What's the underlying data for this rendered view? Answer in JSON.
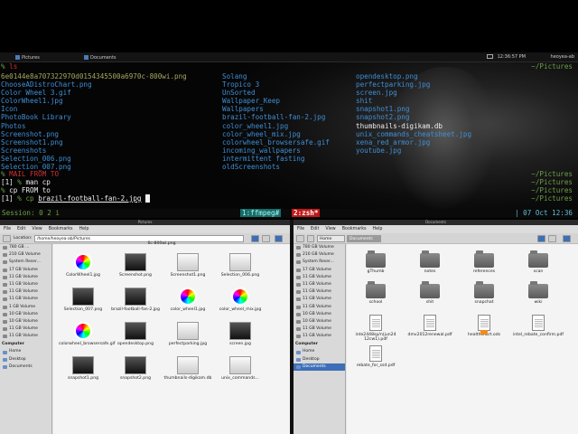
{
  "panel": {
    "tasks": [
      {
        "label": "Pictures"
      },
      {
        "label": "Documents"
      }
    ],
    "clock": "12:36:57 PM",
    "user": "heoyea-ab"
  },
  "terminal": {
    "prompt": "%",
    "cmd1": "ls",
    "col1": [
      "6e0144e8a707322970d0154345500a6970c-800wi.png",
      "ChooseADistroChart.png",
      "Color Wheel 3.gif",
      "ColorWheel1.jpg",
      "Icon",
      "PhotoBook Library",
      "Photos",
      "Screenshot.png",
      "Screenshot1.png",
      "Screenshots",
      "Selection_006.png",
      "Selection_007.png"
    ],
    "col2": [
      "Solang",
      "Tropico 3",
      "UnSorted",
      "Wallpaper_Keep",
      "Wallpapers",
      "brazil-football-fan-2.jpg",
      "color_wheel1.jpg",
      "color_wheel_mix.jpg",
      "colorwheel_browsersafe.gif",
      "incoming_wallpapers",
      "intermittent fasting",
      "oldScreenshots"
    ],
    "col3": [
      "opendesktop.png",
      "perfectparking.jpg",
      "screen.jpg",
      "shit",
      "snapshot1.png",
      "snapshot2.png",
      "thumbnails-digikam.db",
      "unix_commands_cheatsheet.jpg",
      "xena_red_armor.jpg",
      "youtube.jpg"
    ],
    "cwd": "~/Pictures",
    "line_mail": "MAIL FROM TO",
    "line_man_prefix": "[1]",
    "line_man": "man cp",
    "line_cp": "cp FROM to",
    "line_last_prefix": "[1]",
    "line_last_cmd": "cp",
    "line_last_arg": "brazil-football-fan-2.jpg",
    "session": "Session: 0 2 i",
    "win1": "1:ffmpeg#",
    "win2": "2:zsh*",
    "date": "| 07 Oct 12:36"
  },
  "left_fm": {
    "title": "Pictures",
    "menu": [
      "File",
      "Edit",
      "View",
      "Bookmarks",
      "Help"
    ],
    "location_label": "Location:",
    "location": "/home/heoyea-ab/Pictures",
    "partial_top": "6c-800wi.png",
    "sidebar_devices": [
      "780 GB ...",
      "210 GB Volume",
      "System Reser...",
      "17 GB Volume",
      "11 GB Volume",
      "11 GB Volume",
      "11 GB Volume",
      "11 GB Volume",
      "1 GB Volume",
      "10 GB Volume",
      "10 GB Volume",
      "11 GB Volume",
      "11 GB Volume"
    ],
    "sidebar_computer_hdr": "Computer",
    "sidebar_computer": [
      "Home",
      "Desktop",
      "Documents"
    ],
    "files": [
      {
        "name": "ColorWheel1.jpg",
        "kind": "wheel"
      },
      {
        "name": "Screenshot.png",
        "kind": "dark"
      },
      {
        "name": "Screenshot1.png",
        "kind": "light"
      },
      {
        "name": "Selection_006.png",
        "kind": "light"
      },
      {
        "name": "Selection_007.png",
        "kind": "dark"
      },
      {
        "name": "brazil-football-fan-2.jpg",
        "kind": "dark"
      },
      {
        "name": "color_wheel1.jpg",
        "kind": "wheel"
      },
      {
        "name": "color_wheel_mix.jpg",
        "kind": "wheel"
      },
      {
        "name": "colorwheel_browsersafe.gif",
        "kind": "wheel"
      },
      {
        "name": "opendesktop.png",
        "kind": "dark"
      },
      {
        "name": "perfectparking.jpg",
        "kind": "light"
      },
      {
        "name": "screen.jpg",
        "kind": "dark"
      },
      {
        "name": "snapshot1.png",
        "kind": "dark"
      },
      {
        "name": "snapshot2.png",
        "kind": "dark"
      },
      {
        "name": "thumbnails-digikam.db",
        "kind": "light"
      },
      {
        "name": "unix_commands...",
        "kind": "light"
      }
    ]
  },
  "right_fm": {
    "title": "Documents",
    "menu": [
      "File",
      "Edit",
      "View",
      "Bookmarks",
      "Help"
    ],
    "crumbs": [
      "Home",
      "Documents"
    ],
    "sidebar_devices": [
      "780 GB Volume",
      "210 GB Volume",
      "System Reser...",
      "17 GB Volume",
      "11 GB Volume",
      "11 GB Volume",
      "11 GB Volume",
      "11 GB Volume",
      "11 GB Volume",
      "10 GB Volume",
      "10 GB Volume",
      "11 GB Volume",
      "11 GB Volume"
    ],
    "sidebar_computer_hdr": "Computer",
    "sidebar_computer": [
      "Home",
      "Desktop",
      "Documents"
    ],
    "files": [
      {
        "name": "gThumb",
        "kind": "folder"
      },
      {
        "name": "notes",
        "kind": "folder"
      },
      {
        "name": "references",
        "kind": "folder"
      },
      {
        "name": "scan",
        "kind": "folder"
      },
      {
        "name": "school",
        "kind": "folder"
      },
      {
        "name": "shit",
        "kind": "folder"
      },
      {
        "name": "snapchat",
        "kind": "folder"
      },
      {
        "name": "wiki",
        "kind": "folder"
      },
      {
        "name": "inte2448sp/n(jun24 12cw1).pdf",
        "kind": "doc"
      },
      {
        "name": "dmv2012renewal.pdf",
        "kind": "doc"
      },
      {
        "name": "healthchart.ods",
        "kind": "sheet"
      },
      {
        "name": "intel_rebate_confirm.pdf",
        "kind": "doc"
      },
      {
        "name": "rebate_for_ssd.pdf",
        "kind": "doc"
      }
    ]
  }
}
